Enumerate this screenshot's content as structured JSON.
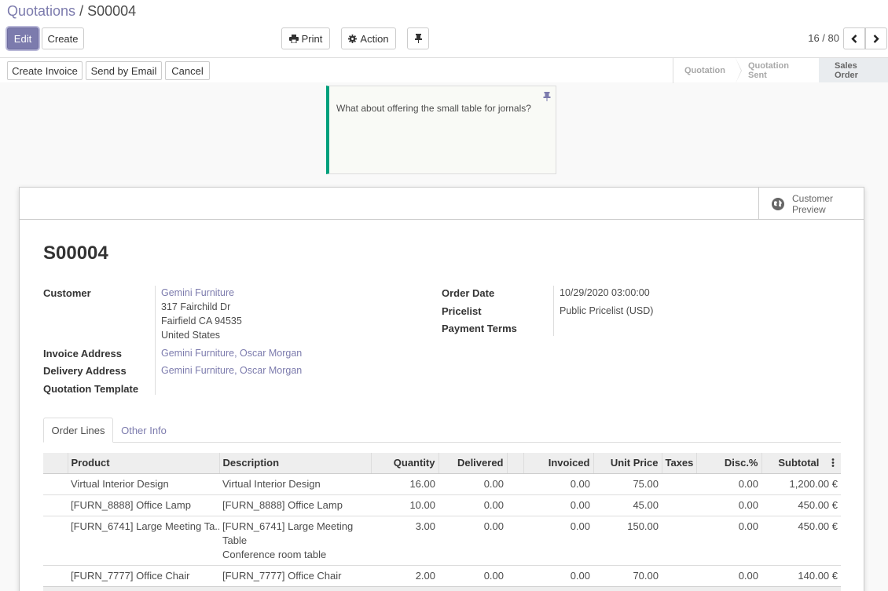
{
  "breadcrumb": {
    "parent": "Quotations",
    "sep": " / ",
    "current": "S00004"
  },
  "toolbar": {
    "edit": "Edit",
    "create": "Create",
    "print": "Print",
    "action": "Action",
    "pager": "16 / 80"
  },
  "statusbar": {
    "buttons": [
      "Create Invoice",
      "Send by Email",
      "Cancel"
    ],
    "stages": [
      "Quotation",
      "Quotation Sent",
      "Sales Order"
    ],
    "active_stage": "Sales Order"
  },
  "note": {
    "text": "What about offering the small table for jornals?"
  },
  "sheet": {
    "preview": [
      "Customer",
      "Preview"
    ],
    "title": "S00004",
    "left_fields": {
      "customer_label": "Customer",
      "customer_name": "Gemini Furniture",
      "customer_addr": [
        "317 Fairchild Dr",
        "Fairfield CA 94535",
        "United States"
      ],
      "invoice_label": "Invoice Address",
      "invoice_value": "Gemini Furniture, Oscar Morgan",
      "delivery_label": "Delivery Address",
      "delivery_value": "Gemini Furniture, Oscar Morgan",
      "template_label": "Quotation Template",
      "template_value": ""
    },
    "right_fields": {
      "order_date_label": "Order Date",
      "order_date_value": "10/29/2020 03:00:00",
      "pricelist_label": "Pricelist",
      "pricelist_value": "Public Pricelist (USD)",
      "payment_terms_label": "Payment Terms",
      "payment_terms_value": ""
    },
    "tabs": [
      "Order Lines",
      "Other Info"
    ],
    "table": {
      "headers": [
        "Product",
        "Description",
        "Quantity",
        "Delivered",
        "",
        "Invoiced",
        "Unit Price",
        "Taxes",
        "Disc.%",
        "Subtotal"
      ],
      "rows": [
        {
          "product": "Virtual Interior Design",
          "description": [
            "Virtual Interior Design"
          ],
          "quantity": "16.00",
          "delivered": "0.00",
          "invoiced": "0.00",
          "unit_price": "75.00",
          "taxes": "",
          "disc": "0.00",
          "subtotal": "1,200.00 €"
        },
        {
          "product": "[FURN_8888] Office Lamp",
          "description": [
            "[FURN_8888] Office Lamp"
          ],
          "quantity": "10.00",
          "delivered": "0.00",
          "invoiced": "0.00",
          "unit_price": "45.00",
          "taxes": "",
          "disc": "0.00",
          "subtotal": "450.00 €"
        },
        {
          "product": "[FURN_6741] Large Meeting Ta...",
          "description": [
            "[FURN_6741] Large Meeting",
            "Table",
            "Conference room table"
          ],
          "quantity": "3.00",
          "delivered": "0.00",
          "invoiced": "0.00",
          "unit_price": "150.00",
          "taxes": "",
          "disc": "0.00",
          "subtotal": "450.00 €"
        },
        {
          "product": "[FURN_7777] Office Chair",
          "description": [
            "[FURN_7777] Office Chair"
          ],
          "quantity": "2.00",
          "delivered": "0.00",
          "invoiced": "0.00",
          "unit_price": "70.00",
          "taxes": "",
          "disc": "0.00",
          "subtotal": "140.00 €"
        }
      ]
    }
  },
  "colors": {
    "primary": "#7c7bad",
    "note_border": "#00a07c"
  }
}
